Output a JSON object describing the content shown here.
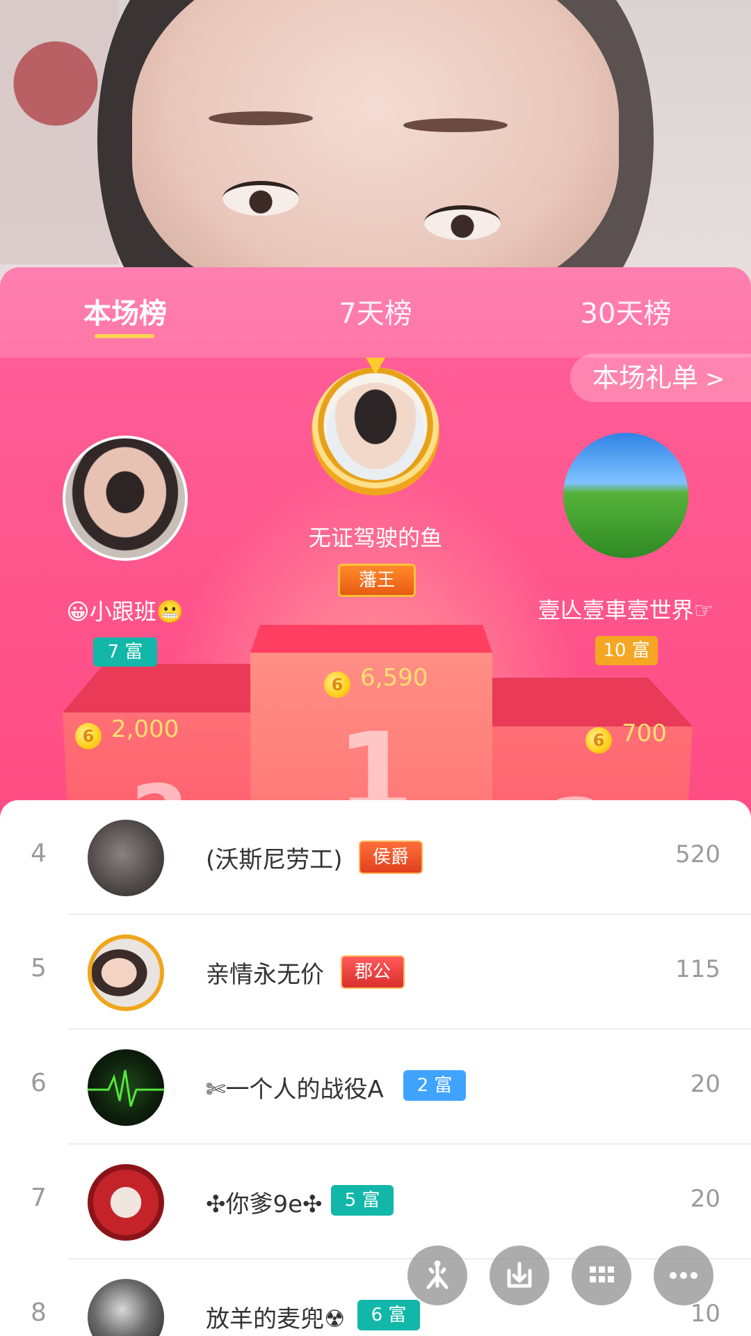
{
  "tabs": {
    "current": "本场榜",
    "week": "7天榜",
    "month": "30天榜"
  },
  "gift_list_button": "本场礼单",
  "podium_numbers": {
    "first": "1",
    "second": "2",
    "third": "3"
  },
  "top3": {
    "first": {
      "name": "无证驾驶的鱼",
      "badge": "藩王",
      "coins": "6,590"
    },
    "second": {
      "name": "😀小跟班😬",
      "badge": "7 富",
      "coins": "2,000"
    },
    "third": {
      "name": "壹亾壹車壹世界☞",
      "badge": "10 富",
      "coins": "700"
    }
  },
  "coin_glyph": "6",
  "ranking": [
    {
      "rank": "4",
      "name": "(沃斯尼劳工)",
      "badge": "侯爵",
      "value": "520"
    },
    {
      "rank": "5",
      "name": "亲情永无价",
      "badge": "郡公",
      "value": "115"
    },
    {
      "rank": "6",
      "name": "✄一个人的战役A",
      "badge": "2 富",
      "value": "20"
    },
    {
      "rank": "7",
      "name": "✣你爹9e✣",
      "badge": "5 富",
      "value": "20"
    },
    {
      "rank": "8",
      "name": "放羊的麦兜☢",
      "badge": "6 富",
      "value": "10"
    }
  ],
  "colors": {
    "tab_bg": "#ff7aa9",
    "stage_bg": "#ff4f86",
    "coin_text": "#ffe071",
    "tab_underline": "#ffd25a"
  },
  "icons": {
    "fab1": "star-spark-icon",
    "fab2": "download-icon",
    "fab3": "grid-icon",
    "fab4": "more-icon"
  }
}
